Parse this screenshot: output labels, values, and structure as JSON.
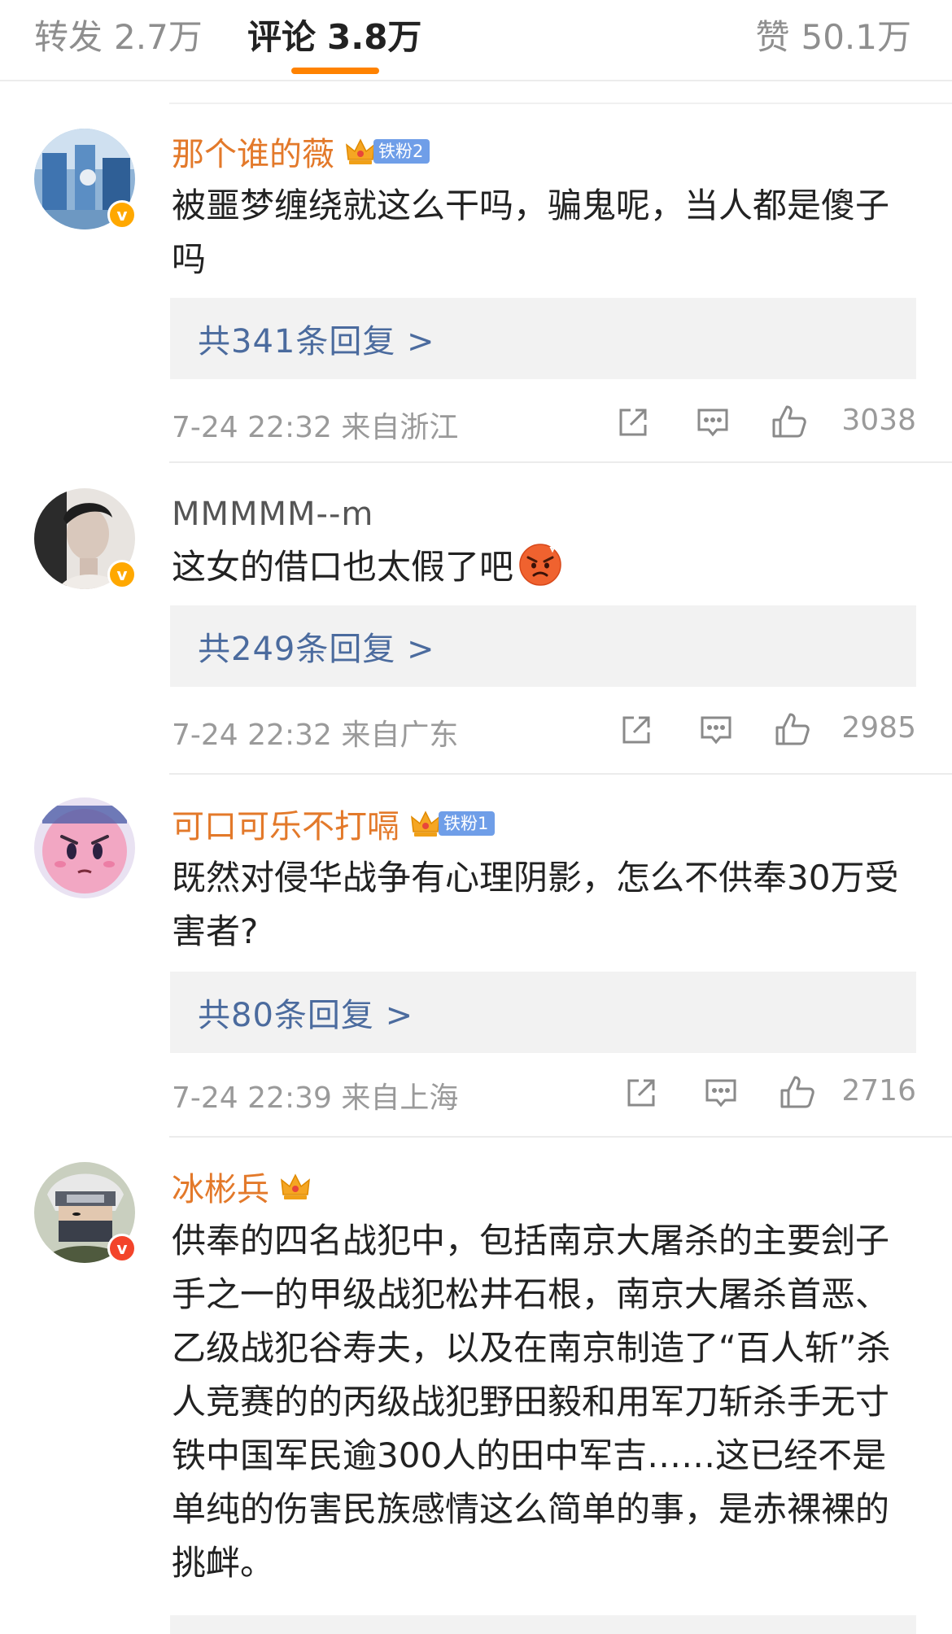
{
  "tabs": {
    "repost": {
      "label": "转发",
      "count": "2.7万"
    },
    "comments": {
      "label": "评论",
      "count": "3.8万"
    },
    "likes": {
      "label": "赞",
      "count": "50.1万"
    }
  },
  "colors": {
    "accent": "#ff8200",
    "username": "#e3792a",
    "reply_link": "#4b6b9e",
    "fan_badge": "#6f9ee8"
  },
  "comments": [
    {
      "username": "那个谁的薇",
      "badge": "铁粉2",
      "text": "被噩梦缠绕就这么干吗，骗鬼呢，当人都是傻子吗",
      "replies": "共341条回复 >",
      "time": "7-24 22:32  来自浙江",
      "likes": "3038"
    },
    {
      "username": "MMMMM--m",
      "text": "这女的借口也太假了吧",
      "emoji": "angry-face",
      "replies": "共249条回复 >",
      "time": "7-24 22:32  来自广东",
      "likes": "2985"
    },
    {
      "username": "可口可乐不打嗝",
      "badge": "铁粉1",
      "text": "既然对侵华战争有心理阴影，怎么不供奉30万受害者?",
      "replies": "共80条回复 >",
      "time": "7-24 22:39  来自上海",
      "likes": "2716"
    },
    {
      "username": "冰彬兵",
      "text": "供奉的四名战犯中，包括南京大屠杀的主要刽子手之一的甲级战犯松井石根，南京大屠杀首恶、乙级战犯谷寿夫，以及在南京制造了“百人斩”杀人竞赛的的丙级战犯野田毅和用军刀斩杀手无寸铁中国军民逾300人的田中军吉……这已经不是单纯的伤害民族感情这么简单的事，是赤裸裸的挑衅。"
    }
  ],
  "badges": {
    "verified": "v"
  }
}
